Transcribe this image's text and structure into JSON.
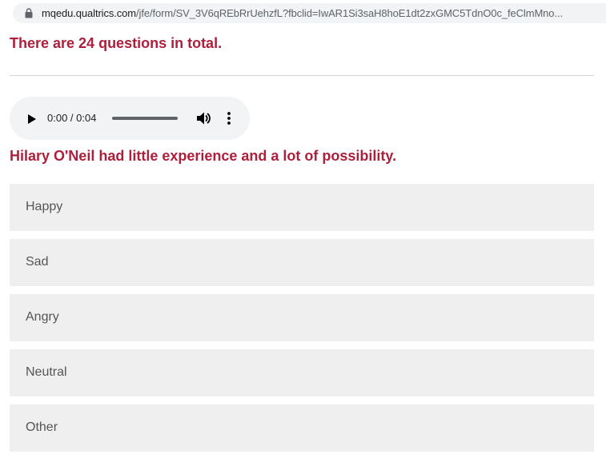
{
  "browser": {
    "url_host": "mqedu.qualtrics.com",
    "url_path": "/jfe/form/SV_3V6qREbRrUehzfL?fbclid=IwAR1Si3saH8hoE1dt2zxGMC5TdnO0c_feClmMno..."
  },
  "survey": {
    "intro": "There are 24 questions in total.",
    "audio": {
      "time": "0:00 / 0:04",
      "play_icon": "play-icon",
      "volume_icon": "volume-icon",
      "more_icon": "more-vert-icon"
    },
    "question": "Hilary O'Neil had little experience and a lot of possibility.",
    "choices": [
      "Happy",
      "Sad",
      "Angry",
      "Neutral",
      "Other"
    ]
  },
  "colors": {
    "accent": "#ad1f3a",
    "choice_bg": "#efefef",
    "player_bg": "#f1f3f4"
  }
}
